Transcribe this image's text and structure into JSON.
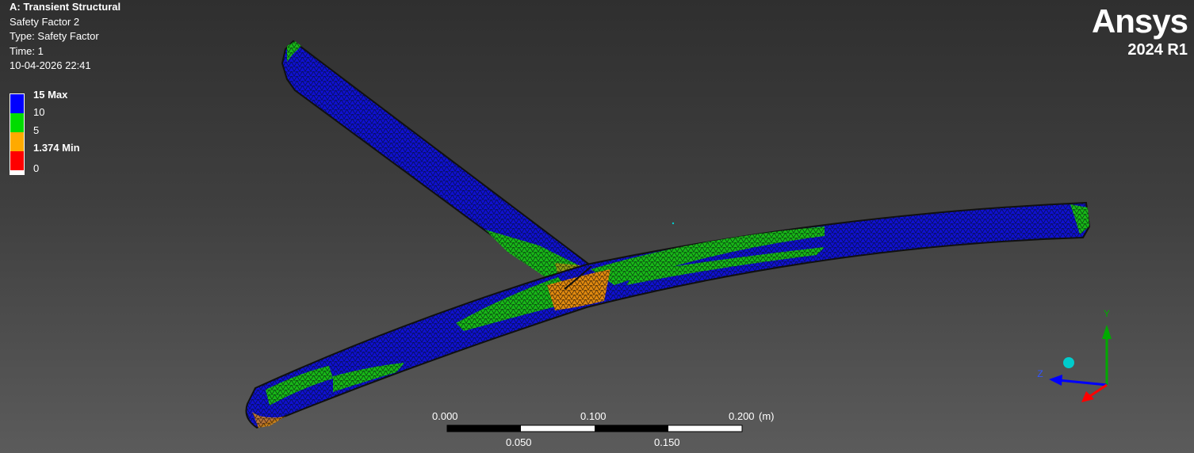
{
  "header": {
    "title": "A: Transient Structural",
    "result_name": "Safety Factor 2",
    "type_line": "Type: Safety Factor",
    "time_line": "Time: 1",
    "timestamp": "10-04-2026 22:41"
  },
  "legend": {
    "bands": [
      {
        "label": "15 Max",
        "bold": true,
        "color": "#0000ff"
      },
      {
        "label": "10",
        "bold": false,
        "color": "#00dd00"
      },
      {
        "label": "5",
        "bold": false,
        "color": "#ffaa00"
      },
      {
        "label": "1.374 Min",
        "bold": true,
        "color": "#ff0000"
      },
      {
        "label": "0",
        "bold": false,
        "color": "#ffffff"
      }
    ]
  },
  "brand": {
    "name": "Ansys",
    "version": "2024 R1"
  },
  "scale_bar": {
    "top_labels": [
      "0.000",
      "0.100",
      "0.200"
    ],
    "unit": "(m)",
    "bottom_labels": [
      "0.050",
      "0.150"
    ]
  },
  "triad": {
    "y_label": "Y",
    "z_label": "Z",
    "y_color": "#00aa00",
    "z_color": "#0000ff",
    "x_color": "#ff0000",
    "iso_sphere_color": "#00cccc"
  }
}
